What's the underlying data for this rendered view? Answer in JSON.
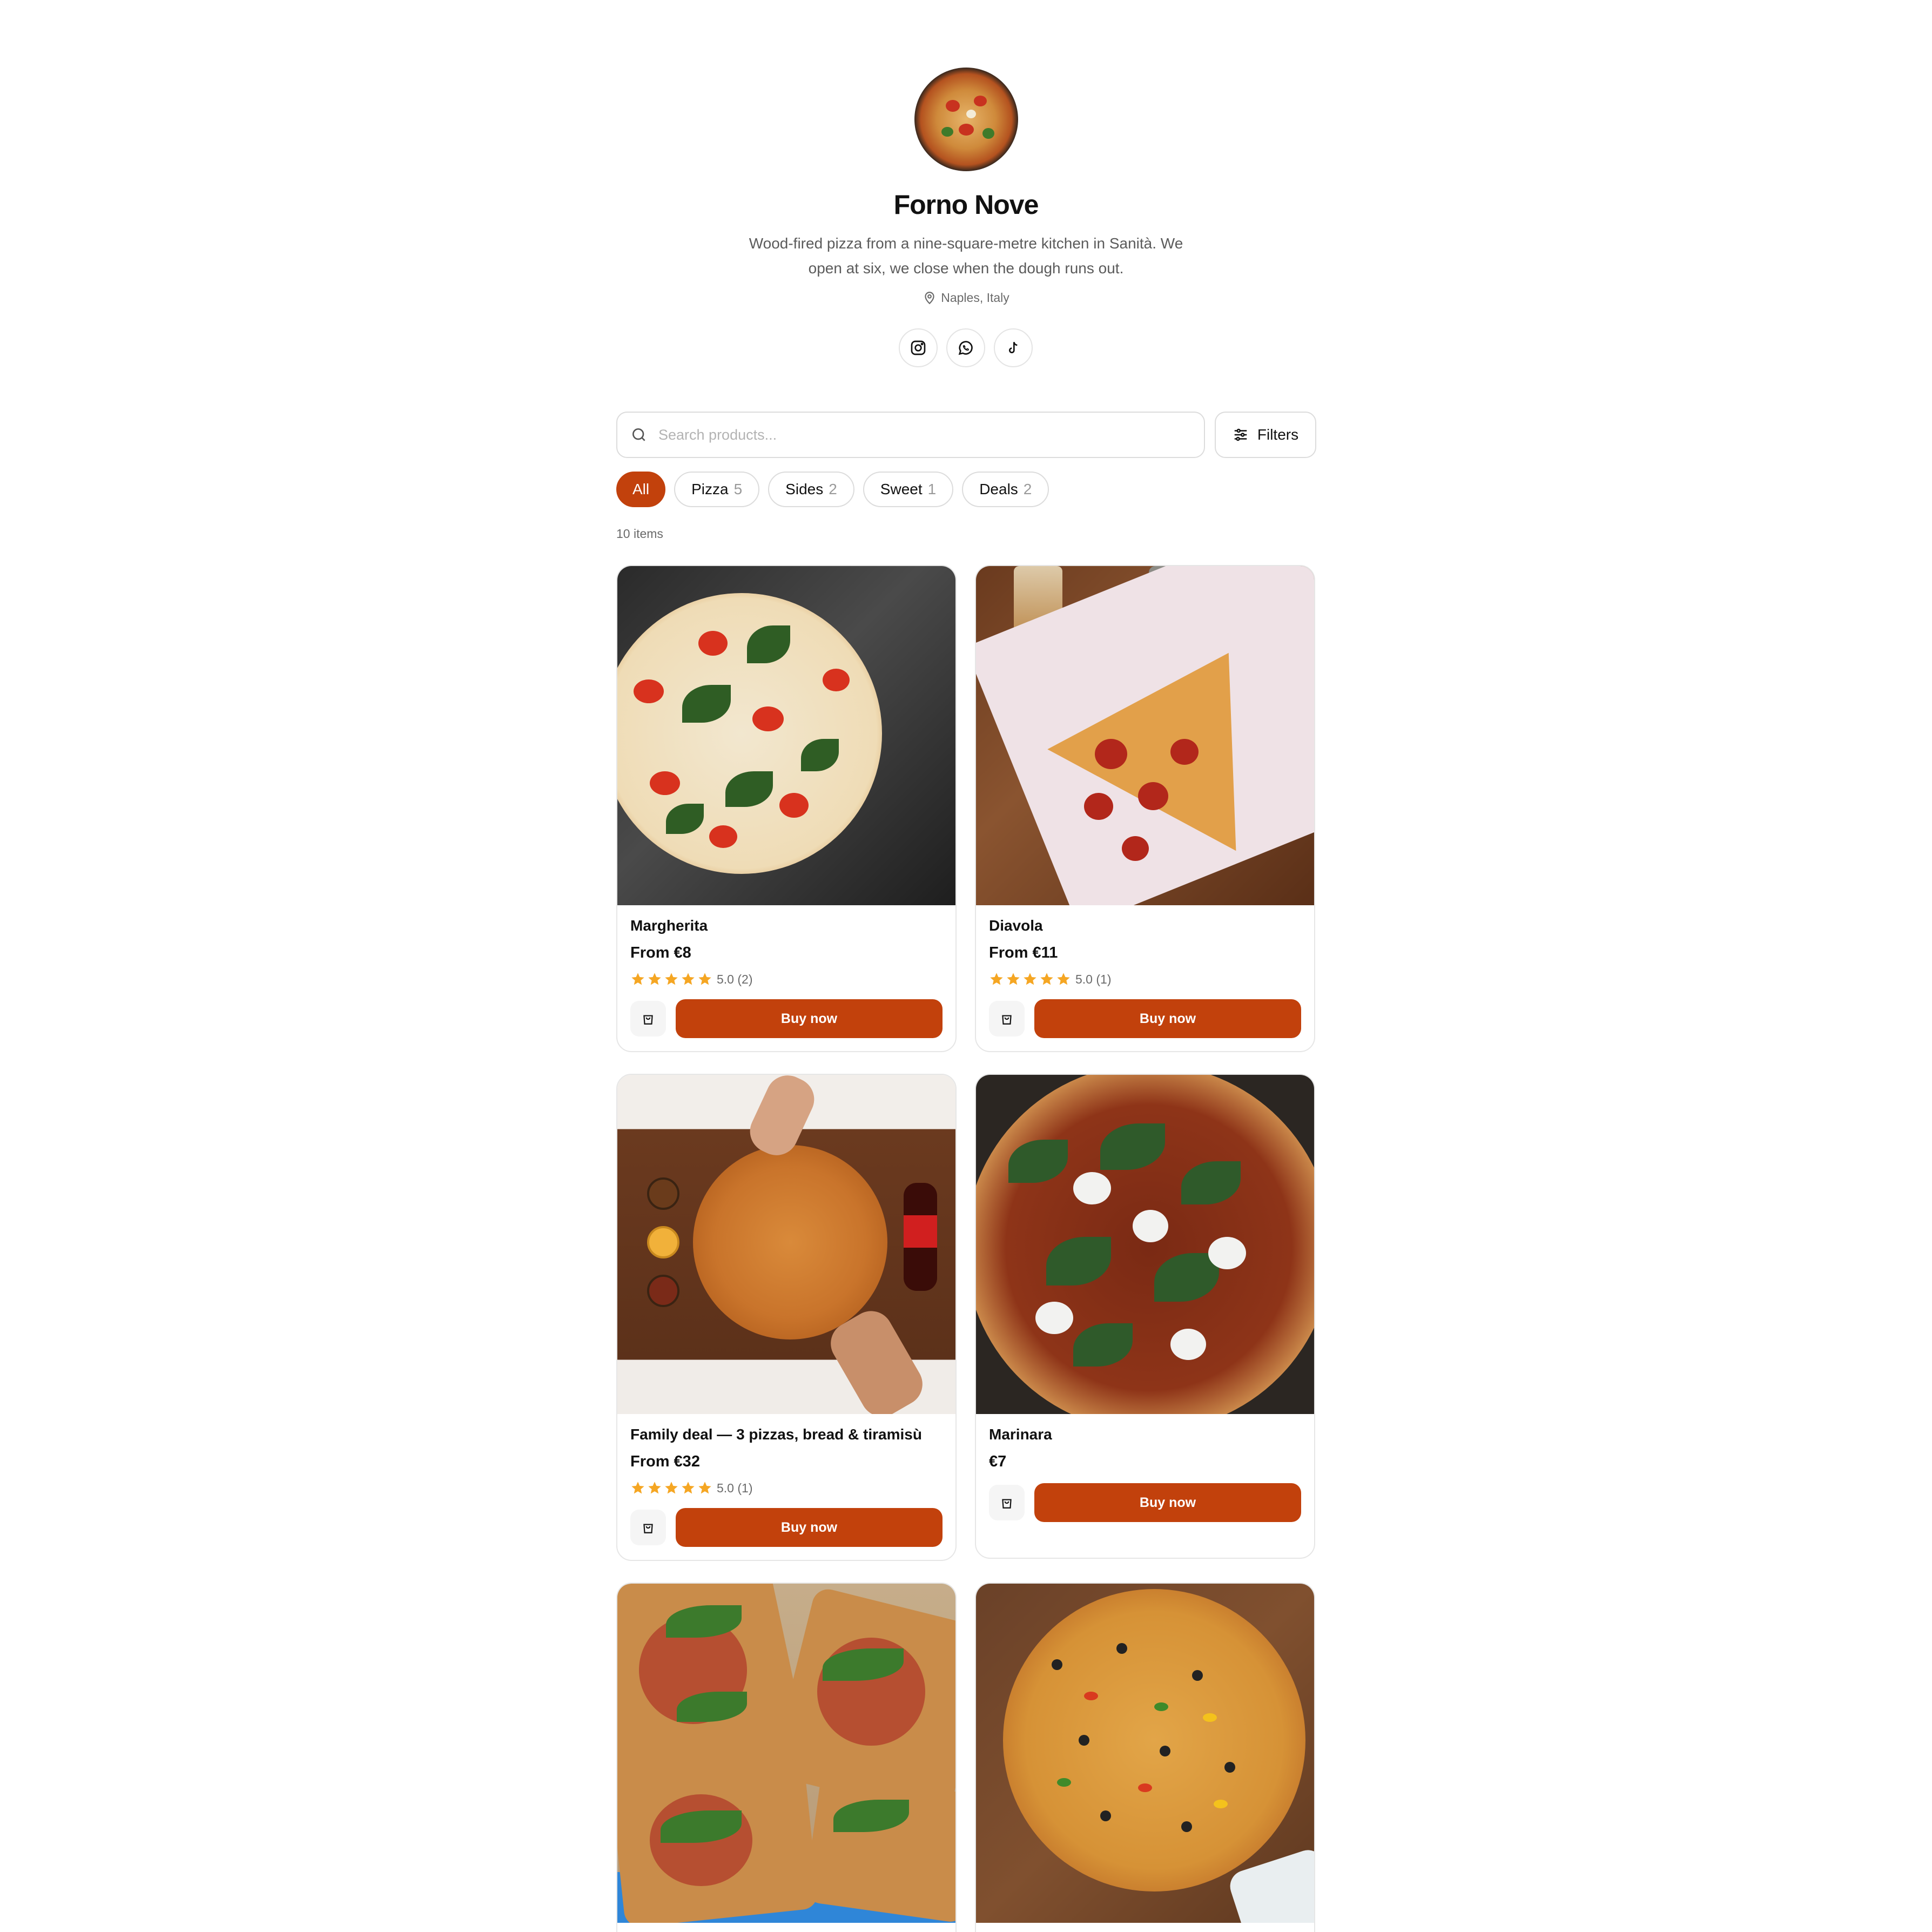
{
  "store": {
    "name": "Forno Nove",
    "bio": "Wood-fired pizza from a nine-square-metre kitchen in Sanità. We open at six, we close when the dough runs out.",
    "location": "Naples, Italy",
    "socials": [
      {
        "name": "instagram",
        "icon": "instagram-icon"
      },
      {
        "name": "whatsapp",
        "icon": "whatsapp-icon"
      },
      {
        "name": "tiktok",
        "icon": "tiktok-icon"
      }
    ]
  },
  "search": {
    "placeholder": "Search products...",
    "value": ""
  },
  "filters": {
    "label": "Filters"
  },
  "categories": [
    {
      "label": "All",
      "count": "",
      "active": true
    },
    {
      "label": "Pizza",
      "count": "5",
      "active": false
    },
    {
      "label": "Sides",
      "count": "2",
      "active": false
    },
    {
      "label": "Sweet",
      "count": "1",
      "active": false
    },
    {
      "label": "Deals",
      "count": "2",
      "active": false
    }
  ],
  "items_count": "10 items",
  "products": [
    {
      "title": "Margherita",
      "price": "From €8",
      "rating_text": "5.0 (2)",
      "stars": 5,
      "buy_label": "Buy now"
    },
    {
      "title": "Diavola",
      "price": "From €11",
      "rating_text": "5.0 (1)",
      "stars": 5,
      "buy_label": "Buy now"
    },
    {
      "title": "Family deal — 3 pizzas, bread & tiramisù",
      "price": "From €32",
      "rating_text": "5.0 (1)",
      "stars": 5,
      "buy_label": "Buy now"
    },
    {
      "title": "Marinara",
      "price": "€7",
      "rating_text": "",
      "stars": 0,
      "buy_label": "Buy now"
    },
    {
      "title": "",
      "price": "",
      "rating_text": "",
      "stars": 0,
      "buy_label": ""
    },
    {
      "title": "",
      "price": "",
      "rating_text": "",
      "stars": 0,
      "buy_label": ""
    }
  ],
  "colors": {
    "accent": "#c2410c",
    "star": "#f5a623",
    "border": "#e6e6e6",
    "muted_text": "#6a6a6a"
  }
}
